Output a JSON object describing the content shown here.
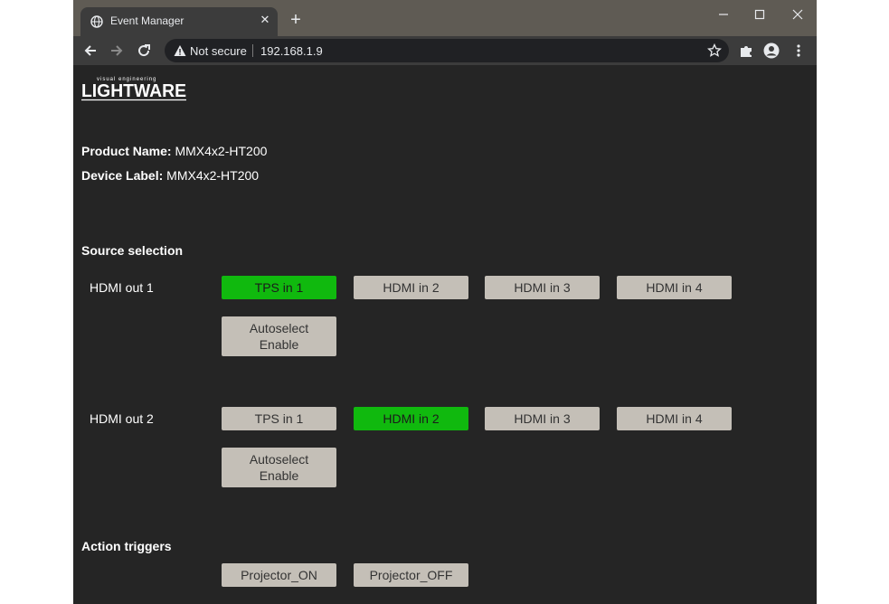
{
  "browser": {
    "tab_title": "Event Manager",
    "security_label": "Not secure",
    "url": "192.168.1.9",
    "icons": {
      "favicon": "globe-icon",
      "tab_close": "close-icon",
      "new_tab": "plus-icon",
      "back": "back-arrow-icon",
      "forward": "forward-arrow-icon",
      "reload": "reload-icon",
      "warning": "warning-icon",
      "bookmark": "star-icon",
      "extensions": "puzzle-icon",
      "profile": "profile-icon",
      "menu": "kebab-menu-icon"
    }
  },
  "logo": {
    "tagline": "visual engineering",
    "name": "LIGHTWARE"
  },
  "product": {
    "name_label": "Product Name:",
    "name_value": "MMX4x2-HT200",
    "device_label": "Device Label:",
    "device_value": "MMX4x2-HT200"
  },
  "source_selection": {
    "heading": "Source selection",
    "outputs": [
      {
        "label": "HDMI out 1",
        "buttons": [
          "TPS in 1",
          "HDMI in 2",
          "HDMI in 3",
          "HDMI in 4"
        ],
        "active_index": 0,
        "autoselect": [
          "Autoselect",
          "Enable"
        ]
      },
      {
        "label": "HDMI out 2",
        "buttons": [
          "TPS in 1",
          "HDMI in 2",
          "HDMI in 3",
          "HDMI in 4"
        ],
        "active_index": 1,
        "autoselect": [
          "Autoselect",
          "Enable"
        ]
      }
    ]
  },
  "action_triggers": {
    "heading": "Action triggers",
    "buttons": [
      "Projector_ON",
      "Projector_OFF"
    ]
  },
  "colors": {
    "active_button": "#10b90e",
    "button": "#c4bfb7",
    "page_background": "#252525"
  }
}
